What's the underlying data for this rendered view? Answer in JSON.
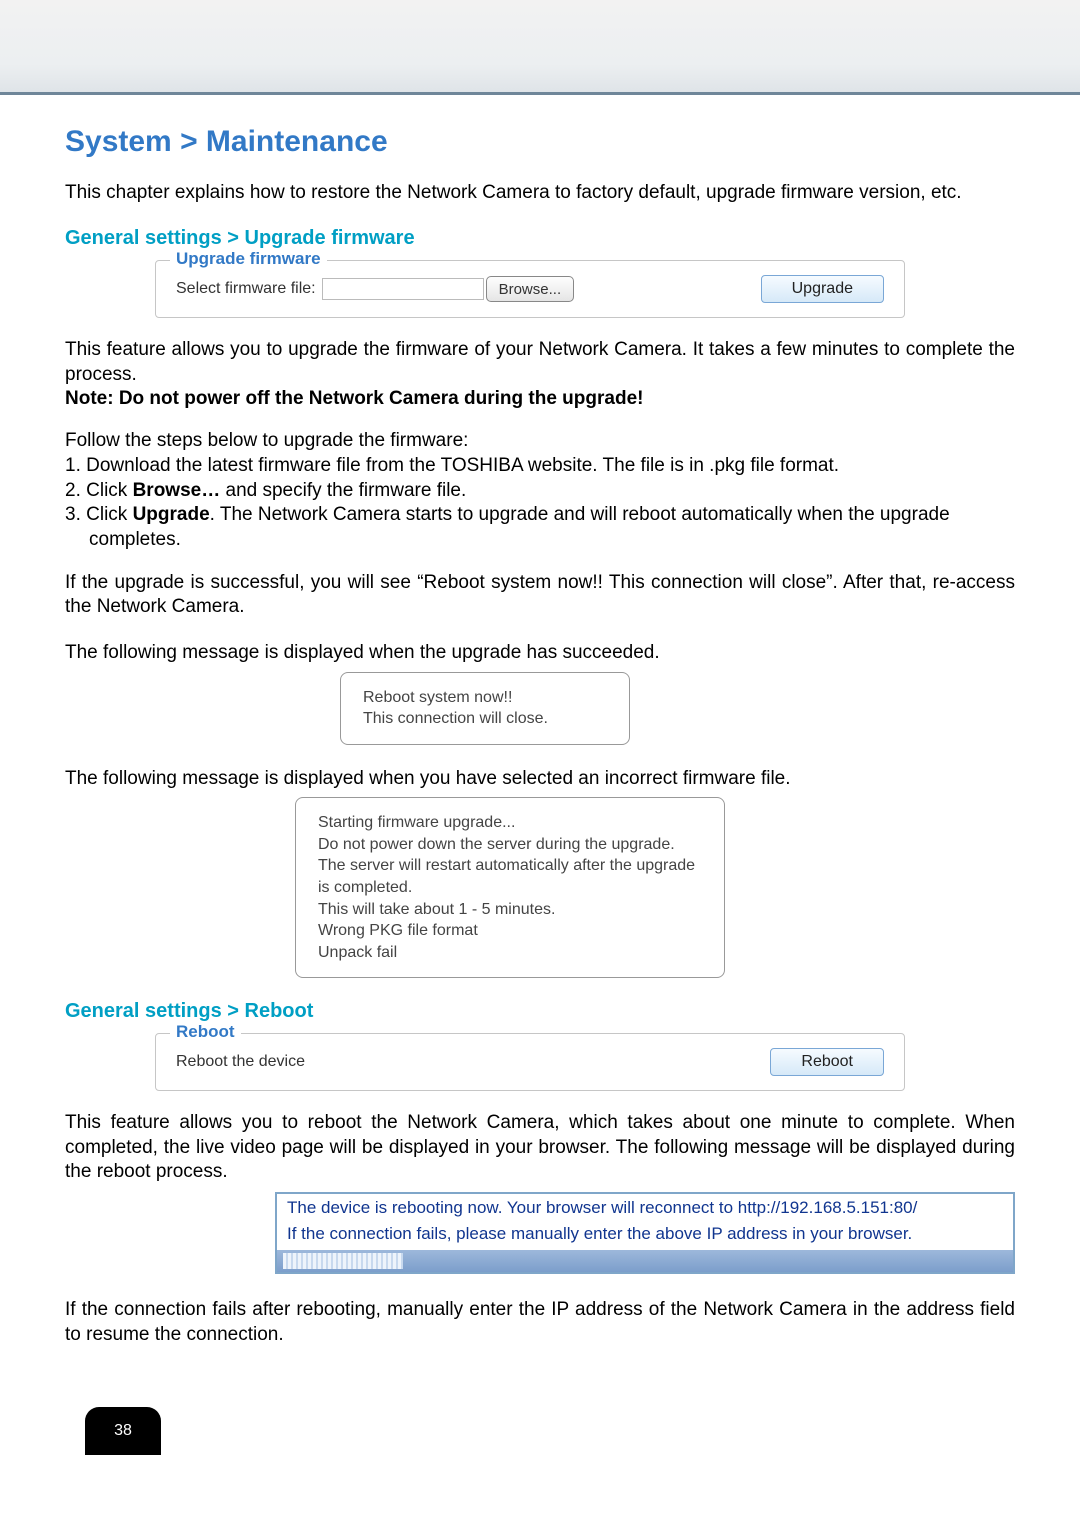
{
  "page": {
    "title": "System > Maintenance",
    "intro": "This chapter explains how to restore the Network Camera to factory default, upgrade firmware version, etc.",
    "page_number": "38"
  },
  "upgrade": {
    "section_head": "General settings > Upgrade firmware",
    "legend": "Upgrade firmware",
    "label": "Select firmware file:",
    "browse_label": "Browse...",
    "upgrade_label": "Upgrade",
    "desc": "This feature allows you to upgrade the firmware of your Network Camera. It takes a few minutes to complete the process.",
    "note": "Note: Do not power off the Network Camera during the upgrade!",
    "steps_intro": "Follow the steps below to upgrade the firmware:",
    "step1": "1. Download the latest firmware file from the TOSHIBA website. The file is in .pkg file format.",
    "step2_a": "2. Click ",
    "step2_b": "Browse…",
    "step2_c": " and specify the firmware file.",
    "step3_a": "3. Click ",
    "step3_b": "Upgrade",
    "step3_c": ". The Network Camera starts to upgrade and will reboot automatically when the upgrade",
    "step3_d": "completes.",
    "after": "If the upgrade is successful, you will see “Reboot system now!! This connection will close”. After that, re-access the Network Camera.",
    "succeeded_intro": "The following message is displayed when the upgrade has succeeded.",
    "succeeded_msg_l1": "Reboot system now!!",
    "succeeded_msg_l2": "This connection will close.",
    "wrong_intro": "The following message is displayed when you have selected an incorrect firmware file.",
    "wrong_msg_l1": "Starting firmware upgrade...",
    "wrong_msg_l2": "Do not power down the server during the upgrade.",
    "wrong_msg_l3": "The server will restart automatically after the upgrade is completed.",
    "wrong_msg_l4": "This will take about 1 - 5 minutes.",
    "wrong_msg_l5": "Wrong PKG file format",
    "wrong_msg_l6": "Unpack fail"
  },
  "reboot": {
    "section_head": "General settings > Reboot",
    "legend": "Reboot",
    "label": "Reboot the device",
    "button_label": "Reboot",
    "desc": "This feature allows you to reboot the Network Camera, which takes about one minute to complete. When completed, the live video page will be displayed in your browser. The following message will be displayed during the reboot process.",
    "blue_l1": "The device is rebooting now. Your browser will reconnect to http://192.168.5.151:80/",
    "blue_l2": "If the connection fails, please manually enter the above IP address in your browser.",
    "after": "If the connection fails after rebooting, manually enter the IP address of the Network Camera in the address field to resume the connection."
  }
}
